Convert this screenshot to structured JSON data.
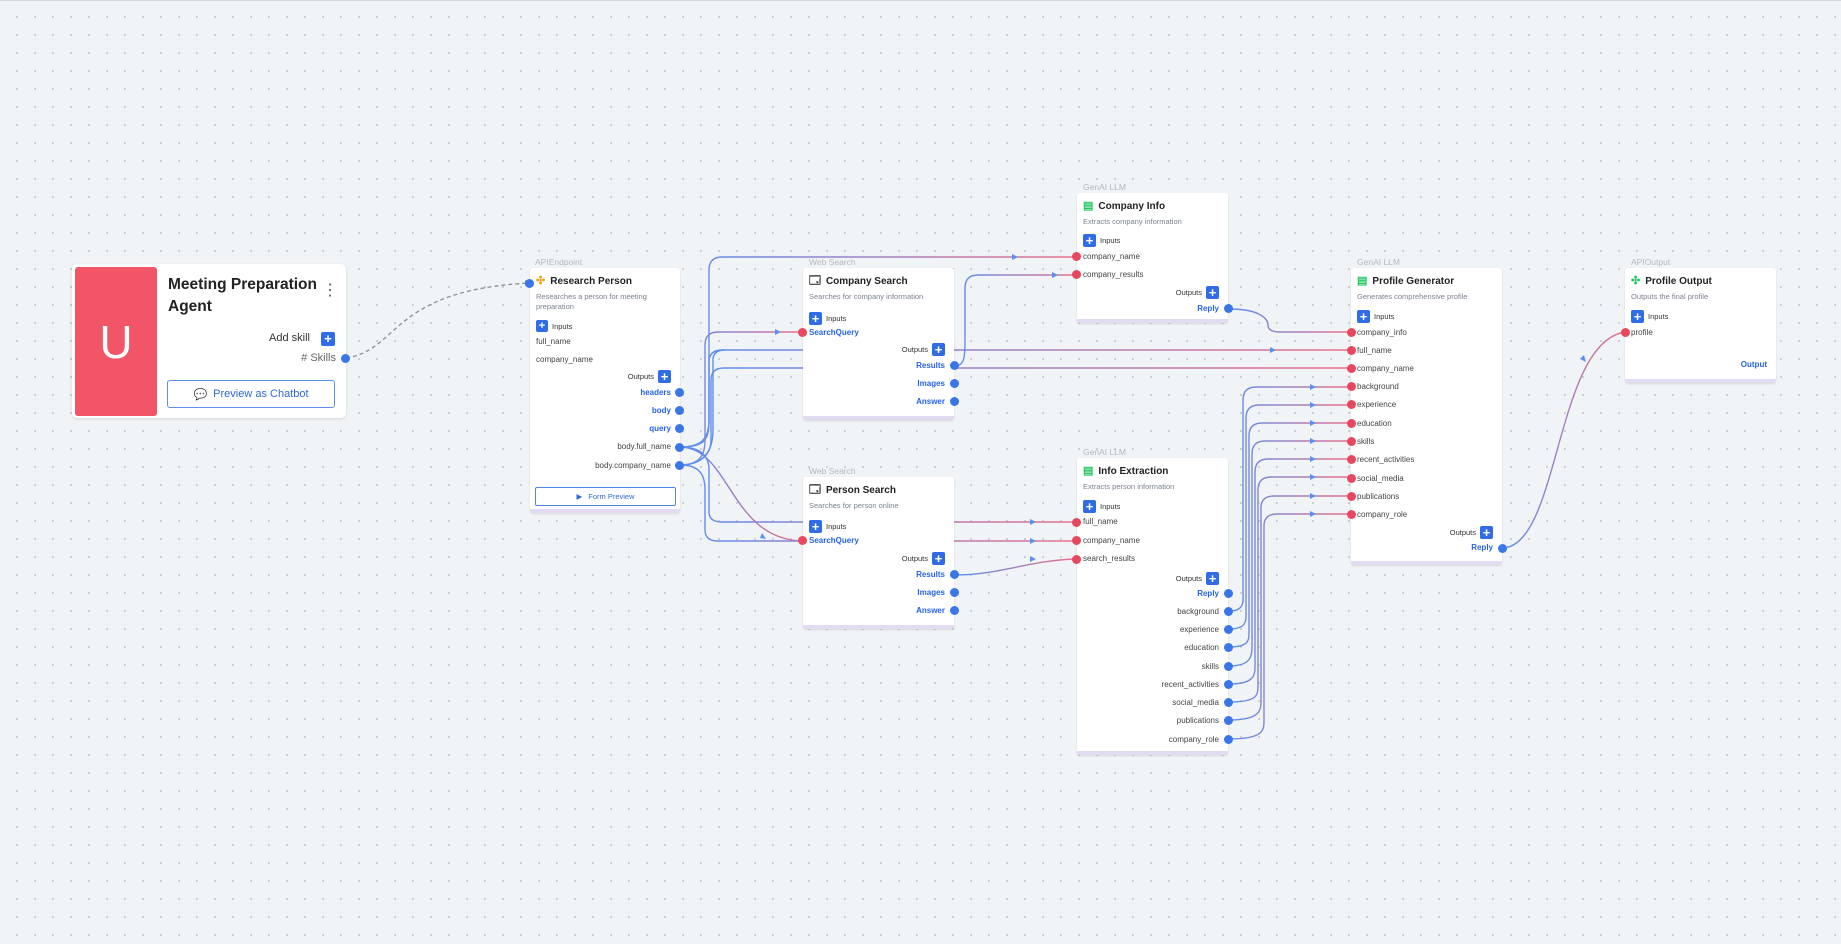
{
  "agent": {
    "avatar_letter": "U",
    "title": "Meeting Preparation Agent",
    "menu_icon": "kebab-icon",
    "add_skill_label": "Add skill",
    "skills_label": "# Skills",
    "preview_label": "Preview as Chatbot",
    "avatar_color": "#f25468"
  },
  "nodes": {
    "research": {
      "type": "APIEndpoint",
      "title": "Research Person",
      "description": "Researches a person for meeting preparation",
      "inputs_label": "Inputs",
      "inputs": [
        "full_name",
        "company_name"
      ],
      "outputs_label": "Outputs",
      "outputs": [
        "headers",
        "body",
        "query",
        "body.full_name",
        "body.company_name"
      ],
      "form_preview_label": "Form Preview"
    },
    "company_search": {
      "type": "Web Search",
      "title": "Company Search",
      "description": "Searches for company information",
      "inputs_label": "Inputs",
      "inputs": [
        "SearchQuery"
      ],
      "outputs_label": "Outputs",
      "outputs": [
        "Results",
        "Images",
        "Answer"
      ]
    },
    "person_search": {
      "type": "Web Search",
      "title": "Person Search",
      "description": "Searches for person online",
      "inputs_label": "Inputs",
      "inputs": [
        "SearchQuery"
      ],
      "outputs_label": "Outputs",
      "outputs": [
        "Results",
        "Images",
        "Answer"
      ]
    },
    "company_info": {
      "type": "GenAI LLM",
      "title": "Company Info",
      "description": "Extracts company information",
      "inputs_label": "Inputs",
      "inputs": [
        "company_name",
        "company_results"
      ],
      "outputs_label": "Outputs",
      "outputs": [
        "Reply"
      ]
    },
    "info_extraction": {
      "type": "GenAI LLM",
      "title": "Info Extraction",
      "description": "Extracts person information",
      "inputs_label": "Inputs",
      "inputs": [
        "full_name",
        "company_name",
        "search_results"
      ],
      "outputs_label": "Outputs",
      "outputs": [
        "Reply",
        "background",
        "experience",
        "education",
        "skills",
        "recent_activities",
        "social_media",
        "publications",
        "company_role"
      ]
    },
    "profile_generator": {
      "type": "GenAI LLM",
      "title": "Profile Generator",
      "description": "Generates comprehensive profile",
      "inputs_label": "Inputs",
      "inputs": [
        "company_info",
        "full_name",
        "company_name",
        "background",
        "experience",
        "education",
        "skills",
        "recent_activities",
        "social_media",
        "publications",
        "company_role"
      ],
      "outputs_label": "Outputs",
      "outputs": [
        "Reply"
      ]
    },
    "profile_output": {
      "type": "APIOutput",
      "title": "Profile Output",
      "description": "Outputs the final profile",
      "inputs_label": "Inputs",
      "inputs": [
        "profile"
      ],
      "outputs": [
        "Output"
      ]
    }
  },
  "colors": {
    "accent": "#2f6ce5",
    "input_port": "#e8485d",
    "output_port": "#3b76e8",
    "wire_blue": "#5b8ff0",
    "wire_red": "#e8708a"
  }
}
